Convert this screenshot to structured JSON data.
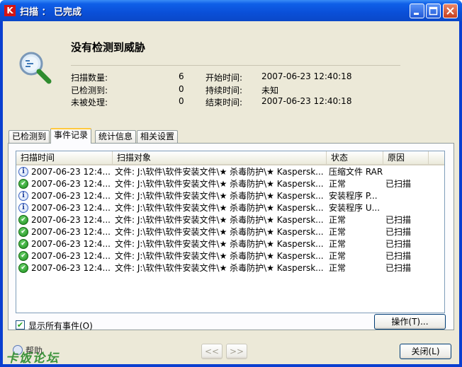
{
  "window": {
    "title": "扫描 ： 已完成",
    "app_icon": "K",
    "controls": [
      "minimize",
      "maximize",
      "close"
    ]
  },
  "summary": {
    "headline": "没有检测到威胁",
    "left": [
      {
        "label": "扫描数量:",
        "value": "6"
      },
      {
        "label": "已检测到:",
        "value": "0"
      },
      {
        "label": "未被处理:",
        "value": "0"
      }
    ],
    "right": [
      {
        "label": "开始时间:",
        "value": "2007-06-23 12:40:18"
      },
      {
        "label": "持续时间:",
        "value": "未知"
      },
      {
        "label": "结束时间:",
        "value": "2007-06-23 12:40:18"
      }
    ]
  },
  "tabs": [
    {
      "label": "已检测到",
      "active": false
    },
    {
      "label": "事件记录",
      "active": true
    },
    {
      "label": "统计信息",
      "active": false
    },
    {
      "label": "相关设置",
      "active": false
    }
  ],
  "table": {
    "columns": [
      "扫描时间",
      "扫描对象",
      "状态",
      "原因"
    ],
    "rows": [
      {
        "icon": "info-icon",
        "time": "2007-06-23 12:4...",
        "object": "文件: J:\\软件\\软件安装文件\\★ 杀毒防护\\★ Kaspersk...",
        "status": "压缩文件 RAR",
        "reason": ""
      },
      {
        "icon": "ok-icon",
        "time": "2007-06-23 12:4...",
        "object": "文件: J:\\软件\\软件安装文件\\★ 杀毒防护\\★ Kaspersk...",
        "status": "正常",
        "reason": "已扫描"
      },
      {
        "icon": "info-icon",
        "time": "2007-06-23 12:4...",
        "object": "文件: J:\\软件\\软件安装文件\\★ 杀毒防护\\★ Kaspersk...",
        "status": "安装程序 P...",
        "reason": ""
      },
      {
        "icon": "info-icon",
        "time": "2007-06-23 12:4...",
        "object": "文件: J:\\软件\\软件安装文件\\★ 杀毒防护\\★ Kaspersk...",
        "status": "安装程序 U...",
        "reason": ""
      },
      {
        "icon": "ok-icon",
        "time": "2007-06-23 12:4...",
        "object": "文件: J:\\软件\\软件安装文件\\★ 杀毒防护\\★ Kaspersk...",
        "status": "正常",
        "reason": "已扫描"
      },
      {
        "icon": "ok-icon",
        "time": "2007-06-23 12:4...",
        "object": "文件: J:\\软件\\软件安装文件\\★ 杀毒防护\\★ Kaspersk...",
        "status": "正常",
        "reason": "已扫描"
      },
      {
        "icon": "ok-icon",
        "time": "2007-06-23 12:4...",
        "object": "文件: J:\\软件\\软件安装文件\\★ 杀毒防护\\★ Kaspersk...",
        "status": "正常",
        "reason": "已扫描"
      },
      {
        "icon": "ok-icon",
        "time": "2007-06-23 12:4...",
        "object": "文件: J:\\软件\\软件安装文件\\★ 杀毒防护\\★ Kaspersk...",
        "status": "正常",
        "reason": "已扫描"
      },
      {
        "icon": "ok-icon",
        "time": "2007-06-23 12:4...",
        "object": "文件: J:\\软件\\软件安装文件\\★ 杀毒防护\\★ Kaspersk...",
        "status": "正常",
        "reason": "已扫描"
      }
    ]
  },
  "show_all_events": {
    "label": "显示所有事件(O)",
    "checked": true
  },
  "buttons": {
    "action": "操作(T)...",
    "prev": "<<",
    "next": ">>",
    "close": "关闭(L)"
  },
  "help": {
    "label": "帮助"
  },
  "watermark": "卡饭论坛"
}
